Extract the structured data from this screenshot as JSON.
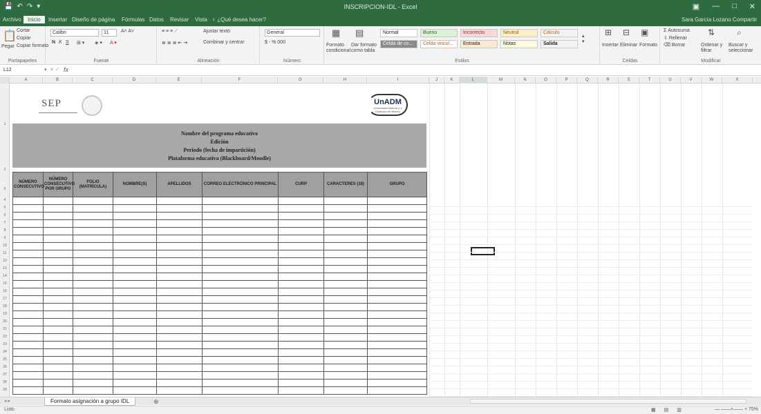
{
  "titlebar": {
    "qat": [
      "💾",
      "↶",
      "↷",
      "▾"
    ],
    "title": "INSCRIPCION-IDL - Excel",
    "controls": [
      "▣",
      "—",
      "□",
      "✕"
    ]
  },
  "tabs": [
    "Archivo",
    "Inicio",
    "Insertar",
    "Diseño de página",
    "Fórmulas",
    "Datos",
    "Revisar",
    "Vista",
    "♀ ¿Qué desea hacer?"
  ],
  "share": {
    "user": "Sara García Lozano",
    "compartir": "Compartir"
  },
  "ribbon": {
    "clipboard": {
      "paste": "Pegar",
      "cut": "Cortar",
      "copy": "Copiar",
      "format_painter": "Copiar formato",
      "label": "Portapapeles"
    },
    "font": {
      "font_name": "Calibri",
      "font_size": "11",
      "bold": "N",
      "italic": "K",
      "underline": "S",
      "label": "Fuente"
    },
    "alignment": {
      "wrap": "Ajustar texto",
      "merge": "Combinar y centrar",
      "label": "Alineación"
    },
    "number": {
      "format": "General",
      "currency": "$ - % 000",
      "label": "Número"
    },
    "styles": {
      "conditional": "Formato condicional",
      "as_table": "Dar formato como tabla",
      "cells": [
        "Normal",
        "Bueno",
        "Incorrecto",
        "Neutral",
        "Cálculo",
        "Celda de co...",
        "Celda vincul...",
        "Entrada",
        "Notas",
        "Salida"
      ],
      "label": "Estilos"
    },
    "cells": {
      "insert": "Insertar",
      "delete": "Eliminar",
      "format": "Formato",
      "label": "Celdas"
    },
    "editing": {
      "autosum": "Autosuma",
      "fill": "Rellenar",
      "clear": "Borrar",
      "sort": "Ordenar y filtrar",
      "find": "Buscar y seleccionar",
      "label": "Modificar"
    }
  },
  "formula_bar": {
    "namebox": "L12",
    "fx": "fx",
    "content": ""
  },
  "columns": [
    "A",
    "B",
    "C",
    "D",
    "E",
    "F",
    "G",
    "H",
    "I",
    "J",
    "K",
    "L",
    "M",
    "N",
    "O",
    "P",
    "Q",
    "R",
    "S",
    "T",
    "U",
    "V",
    "W",
    "X"
  ],
  "rows": [
    "1",
    "2",
    "3",
    "4",
    "5",
    "6",
    "7",
    "8",
    "9",
    "10",
    "11",
    "12",
    "13",
    "14",
    "15",
    "16",
    "17",
    "18",
    "19",
    "20",
    "21",
    "22",
    "23",
    "24",
    "25",
    "26",
    "27",
    "28",
    "29",
    "30",
    "31",
    "32",
    "33"
  ],
  "logos": {
    "sep": "SEP",
    "unadm": "UnADM",
    "unadm_sub": "Universidad Abierta y a Distancia de México"
  },
  "banner": {
    "line1": "Nombre del programa educativo",
    "line2": "Edición",
    "line3": "Periodo (fecha de impartición)",
    "line4": "Plataforma educativa (Blackboard/Moodle)"
  },
  "table": {
    "headers": [
      "NÚMERO CONSECUTIVO",
      "NÚMERO CONSECUTIVO POR GRUPO",
      "FOLIO (MATRÍCULA)",
      "NOMBRE(S)",
      "APELLIDOS",
      "CORREO ELECTRÓNICO PRINCIPAL",
      "CURP",
      "CARACTERES (18)",
      "GRUPO"
    ]
  },
  "sheet_tab": "Formato asignación a grupo IDL",
  "add_sheet": "⊕",
  "status": {
    "ready": "Listo",
    "views": [
      "▦",
      "▤",
      "▥"
    ],
    "zoom": "— ——+—— + 75%"
  }
}
